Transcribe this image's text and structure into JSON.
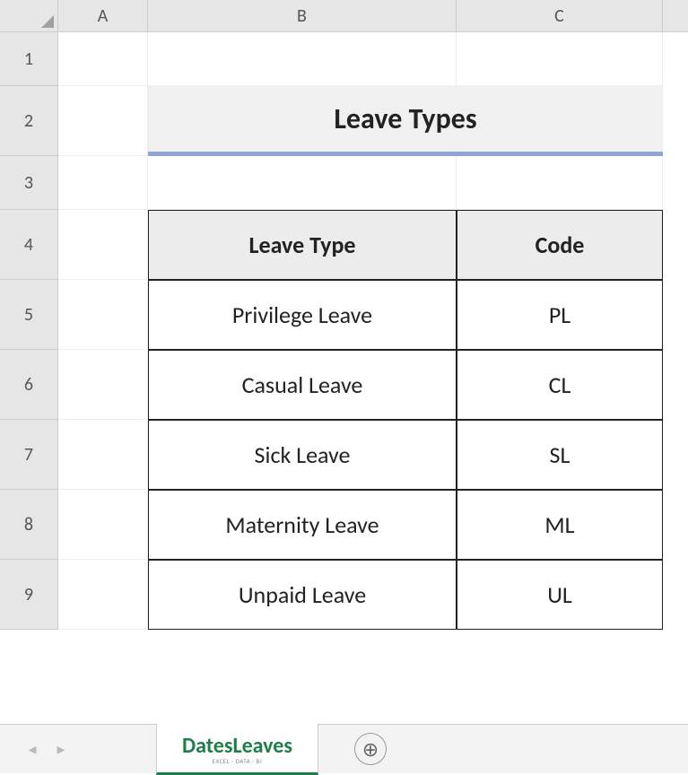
{
  "columns": [
    "A",
    "B",
    "C"
  ],
  "rows": [
    "1",
    "2",
    "3",
    "4",
    "5",
    "6",
    "7",
    "8",
    "9"
  ],
  "title": "Leave Types",
  "headers": {
    "type": "Leave Type",
    "code": "Code"
  },
  "leaves": [
    {
      "type": "Privilege Leave",
      "code": "PL"
    },
    {
      "type": "Casual Leave",
      "code": "CL"
    },
    {
      "type": "Sick Leave",
      "code": "SL"
    },
    {
      "type": "Maternity Leave",
      "code": "ML"
    },
    {
      "type": "Unpaid Leave",
      "code": "UL"
    }
  ],
  "tab": {
    "name": "DatesLeaves",
    "sub": "EXCEL · DATA · BI"
  },
  "icons": {
    "prev": "◂",
    "next": "▸",
    "add": "⊕"
  }
}
